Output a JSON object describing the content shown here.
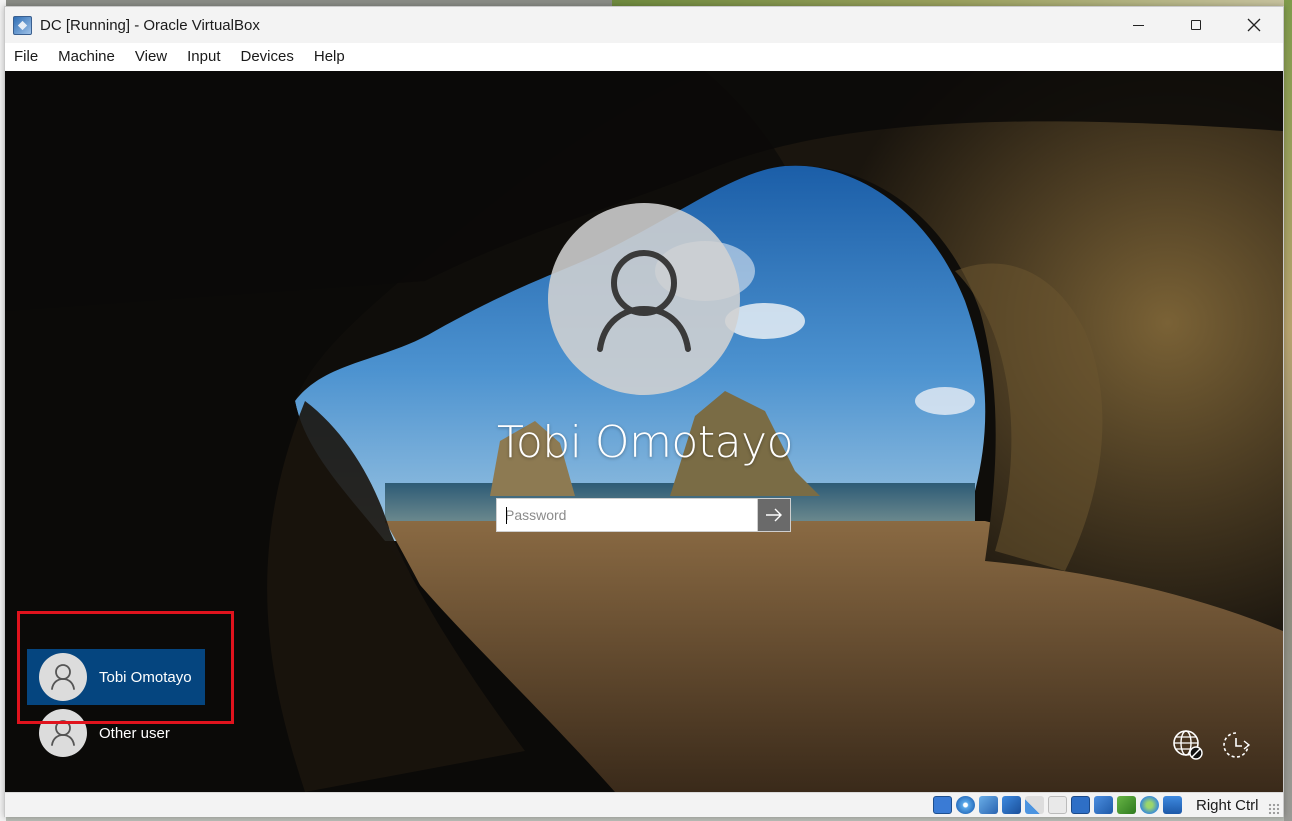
{
  "window": {
    "title": "DC [Running] - Oracle VirtualBox"
  },
  "menu": {
    "items": [
      "File",
      "Machine",
      "View",
      "Input",
      "Devices",
      "Help"
    ]
  },
  "login": {
    "user_name": "Tobi Omotayo",
    "password_placeholder": "Password",
    "password_value": ""
  },
  "user_list": [
    {
      "name": "Tobi Omotayo",
      "selected": true
    },
    {
      "name": "Other user",
      "selected": false
    }
  ],
  "bottom_right_icons": [
    "network-globe-icon",
    "power-accessibility-icon"
  ],
  "statusbar": {
    "icons": [
      "hard-disk-icon",
      "optical-drive-icon",
      "audio-icon",
      "network-adapter-icon",
      "usb-icon",
      "shared-folders-icon",
      "display-icon",
      "video-capture-icon",
      "vm-activity-icon",
      "guest-additions-icon",
      "mouse-integration-icon"
    ],
    "host_key": "Right Ctrl"
  },
  "colors": {
    "selected_tile": "#05457f",
    "highlight_box": "#e0131d"
  }
}
